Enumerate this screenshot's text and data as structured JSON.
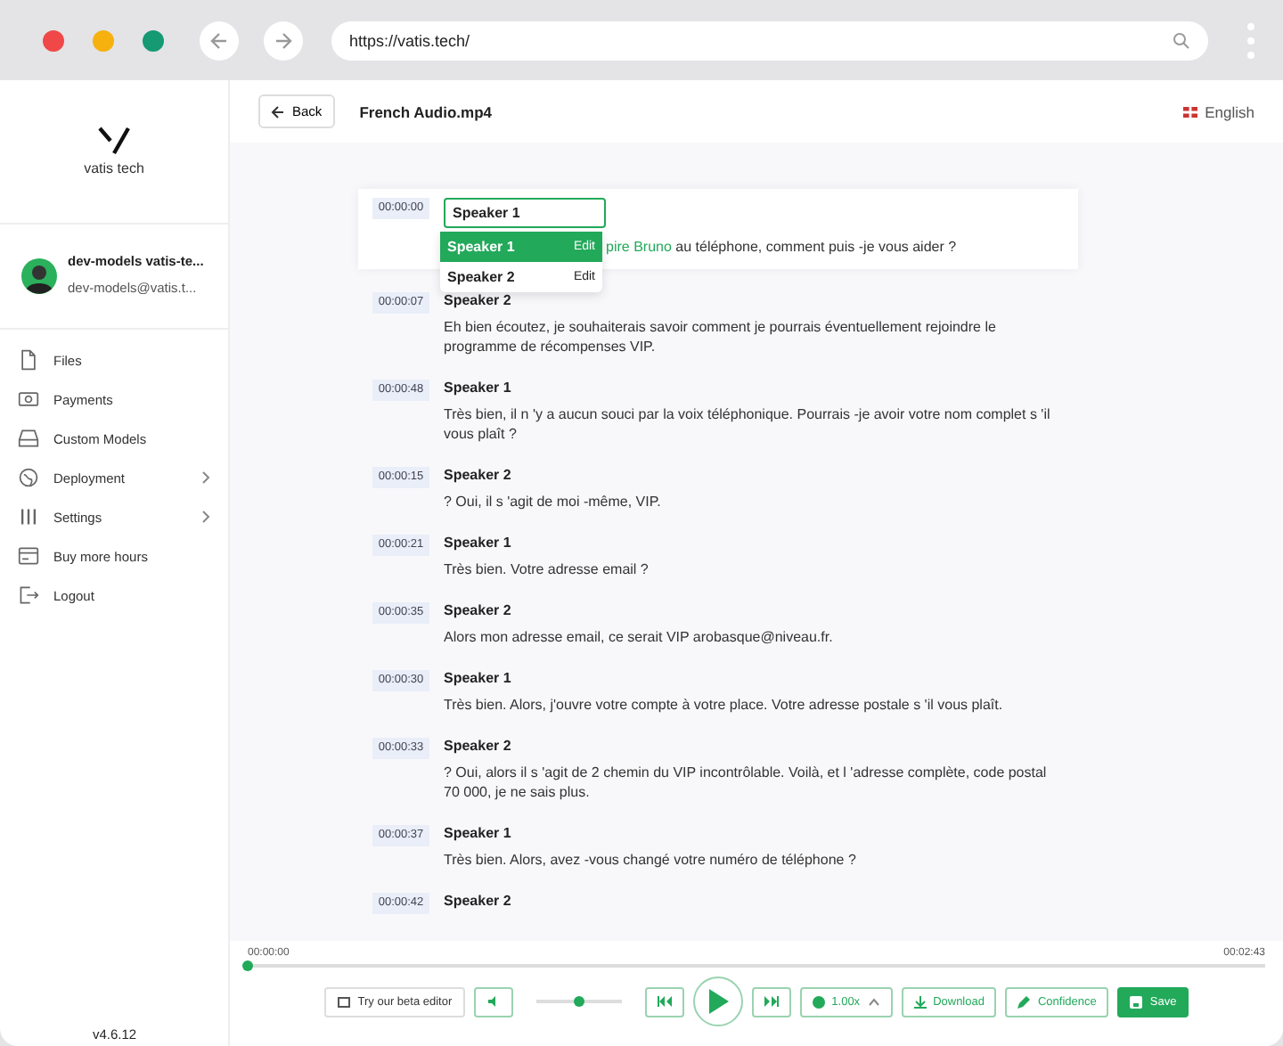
{
  "browser": {
    "url": "https://vatis.tech/"
  },
  "sidebar": {
    "logo": "vatis tech",
    "user": {
      "name": "dev-models vatis-te...",
      "email": "dev-models@vatis.t..."
    },
    "items": [
      {
        "label": "Files",
        "submenu": false
      },
      {
        "label": "Payments",
        "submenu": false
      },
      {
        "label": "Custom Models",
        "submenu": false
      },
      {
        "label": "Deployment",
        "submenu": true
      },
      {
        "label": "Settings",
        "submenu": true
      },
      {
        "label": "Buy more hours",
        "submenu": false
      },
      {
        "label": "Logout",
        "submenu": false
      }
    ],
    "version": "v4.6.12"
  },
  "header": {
    "back": "Back",
    "title": "French Audio.mp4",
    "language": "English"
  },
  "speaker_menu": {
    "value": "Speaker 1",
    "options": [
      {
        "label": "Speaker 1",
        "action": "Edit",
        "selected": true
      },
      {
        "label": "Speaker 2",
        "action": "Edit",
        "selected": false
      }
    ]
  },
  "segments": [
    {
      "kind": "editing",
      "time": "00:00:00",
      "highlight": "pire Bruno",
      "text": " au téléphone, comment puis -je vous aider ?"
    },
    {
      "kind": "line",
      "time": "00:00:07",
      "speaker": "Speaker 2",
      "text": "Eh bien écoutez, je souhaiterais savoir comment je pourrais éventuellement rejoindre le programme de récompenses VIP."
    },
    {
      "kind": "line",
      "time": "00:00:48",
      "speaker": "Speaker 1",
      "text": "Très bien, il n 'y a aucun souci par la voix téléphonique. Pourrais -je avoir votre nom complet s 'il vous plaît ?"
    },
    {
      "kind": "line",
      "time": "00:00:15",
      "speaker": "Speaker 2",
      "text": "? Oui, il s 'agit de moi -même, VIP."
    },
    {
      "kind": "line",
      "time": "00:00:21",
      "speaker": "Speaker 1",
      "text": "Très bien. Votre adresse email ?"
    },
    {
      "kind": "line",
      "time": "00:00:35",
      "speaker": "Speaker 2",
      "text": "Alors mon adresse email, ce serait VIP arobasque@niveau.fr."
    },
    {
      "kind": "line",
      "time": "00:00:30",
      "speaker": "Speaker 1",
      "text": "Très bien. Alors, j'ouvre votre compte à votre place. Votre adresse postale s 'il vous plaît."
    },
    {
      "kind": "line",
      "time": "00:00:33",
      "speaker": "Speaker 2",
      "text": "? Oui, alors il s 'agit de 2 chemin du VIP incontrôlable. Voilà, et l 'adresse complète, code postal 70 000, je ne sais plus."
    },
    {
      "kind": "line",
      "time": "00:00:37",
      "speaker": "Speaker 1",
      "text": "Très bien. Alors, avez -vous changé votre numéro de téléphone ?"
    },
    {
      "kind": "line",
      "time": "00:00:42",
      "speaker": "Speaker 2"
    }
  ],
  "player": {
    "elapsed": "00:00:00",
    "duration": "00:02:43",
    "progress": {
      "level": 0
    },
    "volume": {
      "level": 0.5
    },
    "beta_editor": "Try our beta editor",
    "speed": "1.00x",
    "download": "Download",
    "confidence": "Confidence",
    "save": "Save"
  }
}
